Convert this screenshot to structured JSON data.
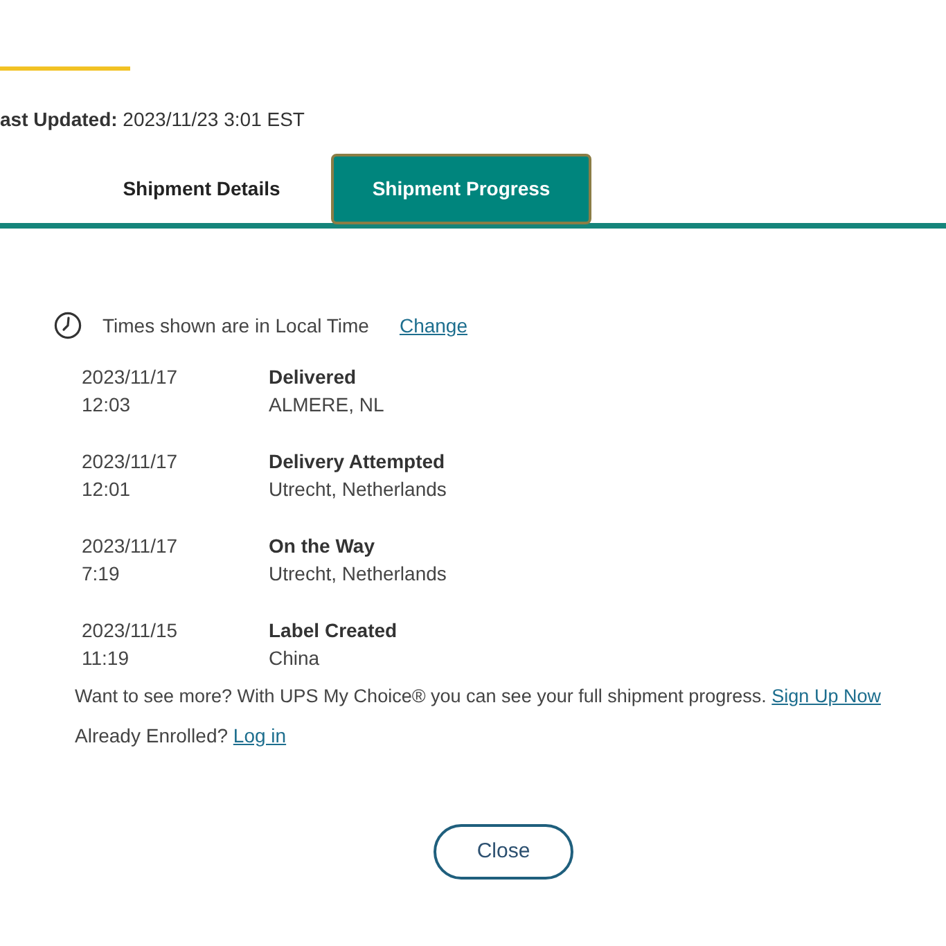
{
  "header": {
    "last_updated": "**ast Updated:** 2023/11/23 3:01 EST"
  },
  "tabs": [
    {
      "label": "Shipment Details",
      "selected": false
    },
    {
      "label": "Shipment Progress",
      "selected": true
    }
  ],
  "timezone_note": {
    "text": "Times shown are in Local Time",
    "link": "Change"
  },
  "events": [
    {
      "date": "2023/11/17",
      "time": "12:03",
      "status": "Delivered",
      "location": "ALMERE, NL"
    },
    {
      "date": "2023/11/17",
      "time": "12:01",
      "status": "Delivery Attempted",
      "location": "Utrecht, Netherlands"
    },
    {
      "date": "2023/11/17",
      "time": "7:19",
      "status": "On the Way",
      "location": "Utrecht, Netherlands"
    },
    {
      "date": "2023/11/15",
      "time": "11:19",
      "status": "Label Created",
      "location": "China"
    }
  ],
  "upsell": {
    "text": "Want to see more? With UPS My Choice® you can see your full shipment progress.",
    "link": "Sign Up Now"
  },
  "enrolled": {
    "text": "Already Enrolled?",
    "link": "Log in"
  },
  "buttons": [
    {
      "label": "Close"
    }
  ]
}
